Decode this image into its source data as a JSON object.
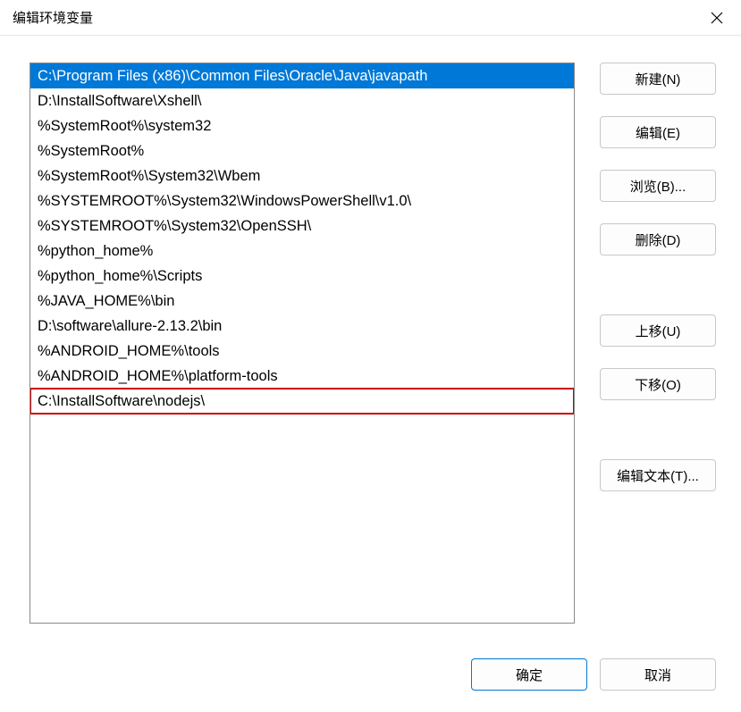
{
  "window": {
    "title": "编辑环境变量"
  },
  "list": {
    "items": [
      "C:\\Program Files (x86)\\Common Files\\Oracle\\Java\\javapath",
      "D:\\InstallSoftware\\Xshell\\",
      "%SystemRoot%\\system32",
      "%SystemRoot%",
      "%SystemRoot%\\System32\\Wbem",
      "%SYSTEMROOT%\\System32\\WindowsPowerShell\\v1.0\\",
      "%SYSTEMROOT%\\System32\\OpenSSH\\",
      "%python_home%",
      "%python_home%\\Scripts",
      "%JAVA_HOME%\\bin",
      "D:\\software\\allure-2.13.2\\bin",
      "%ANDROID_HOME%\\tools",
      "%ANDROID_HOME%\\platform-tools",
      "C:\\InstallSoftware\\nodejs\\"
    ],
    "selectedIndex": 0,
    "highlightedIndex": 13
  },
  "buttons": {
    "new": "新建(N)",
    "edit": "编辑(E)",
    "browse": "浏览(B)...",
    "delete": "删除(D)",
    "moveUp": "上移(U)",
    "moveDown": "下移(O)",
    "editText": "编辑文本(T)...",
    "ok": "确定",
    "cancel": "取消"
  }
}
